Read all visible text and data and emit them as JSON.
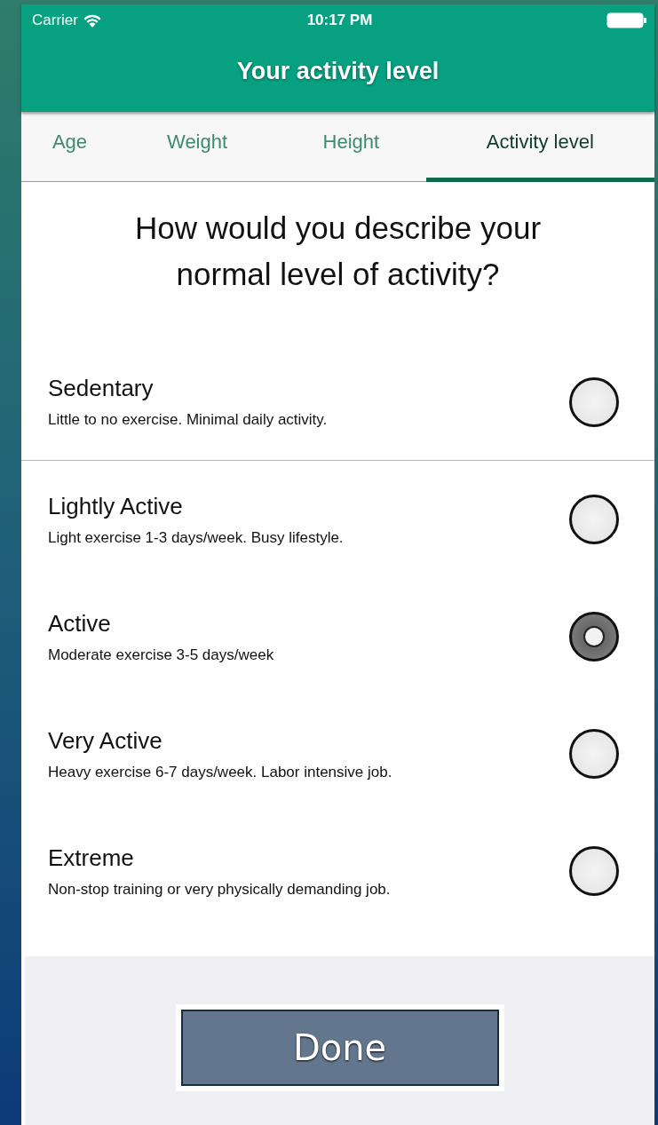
{
  "status_bar": {
    "carrier": "Carrier",
    "time": "10:17 PM"
  },
  "title": "Your activity level",
  "tabs": [
    {
      "label": "Age",
      "selected": false
    },
    {
      "label": "Weight",
      "selected": false
    },
    {
      "label": "Height",
      "selected": false
    },
    {
      "label": "Activity level",
      "selected": true
    }
  ],
  "question": "How would you describe your normal level of activity?",
  "options": [
    {
      "name": "Sedentary",
      "description": "Little to no exercise. Minimal daily activity.",
      "selected": false,
      "divider": true
    },
    {
      "name": "Lightly Active",
      "description": "Light exercise 1-3 days/week. Busy lifestyle.",
      "selected": false,
      "divider": false
    },
    {
      "name": "Active",
      "description": "Moderate exercise 3-5 days/week",
      "selected": true,
      "divider": false
    },
    {
      "name": "Very Active",
      "description": "Heavy exercise 6-7 days/week. Labor intensive job.",
      "selected": false,
      "divider": false
    },
    {
      "name": "Extreme",
      "description": "Non-stop training or very physically demanding job.",
      "selected": false,
      "divider": false
    }
  ],
  "done_button": "Done"
}
